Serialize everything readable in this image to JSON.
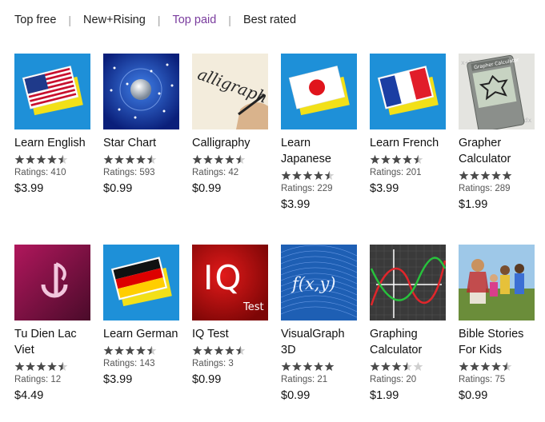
{
  "tabs": [
    {
      "label": "Top free",
      "active": false
    },
    {
      "label": "New+Rising",
      "active": false
    },
    {
      "label": "Top paid",
      "active": true
    },
    {
      "label": "Best rated",
      "active": false
    }
  ],
  "separator": "|",
  "apps": [
    {
      "name": "Learn English",
      "rating": 4.5,
      "ratings": "Ratings: 410",
      "price": "$3.99",
      "icon": "us-flag-icon"
    },
    {
      "name": "Star Chart",
      "rating": 4.5,
      "ratings": "Ratings: 593",
      "price": "$0.99",
      "icon": "star-chart-icon"
    },
    {
      "name": "Calligraphy",
      "rating": 4.5,
      "ratings": "Ratings: 42",
      "price": "$0.99",
      "icon": "calligraphy-icon"
    },
    {
      "name": "Learn Japanese",
      "rating": 4.5,
      "ratings": "Ratings: 229",
      "price": "$3.99",
      "icon": "japan-flag-icon"
    },
    {
      "name": "Learn French",
      "rating": 4.5,
      "ratings": "Ratings: 201",
      "price": "$3.99",
      "icon": "france-flag-icon"
    },
    {
      "name": "Grapher Calculator",
      "rating": 5,
      "ratings": "Ratings: 289",
      "price": "$1.99",
      "icon": "grapher-calculator-icon",
      "icon_text": "Grapher Calculator"
    },
    {
      "name": "Tu Dien Lac Viet",
      "rating": 4.5,
      "ratings": "Ratings: 12",
      "price": "$4.49",
      "icon": "lac-viet-logo-icon"
    },
    {
      "name": "Learn German",
      "rating": 4.5,
      "ratings": "Ratings: 143",
      "price": "$3.99",
      "icon": "germany-flag-icon"
    },
    {
      "name": "IQ Test",
      "rating": 4.5,
      "ratings": "Ratings: 3",
      "price": "$0.99",
      "icon": "iq-test-icon",
      "icon_text": "IQ",
      "icon_subtext": "Test"
    },
    {
      "name": "VisualGraph 3D",
      "rating": 5,
      "ratings": "Ratings: 21",
      "price": "$0.99",
      "icon": "function-graph-icon",
      "icon_text": "f(x,y)"
    },
    {
      "name": "Graphing Calculator",
      "rating": 3.5,
      "ratings": "Ratings: 20",
      "price": "$1.99",
      "icon": "graphing-calculator-icon"
    },
    {
      "name": "Bible Stories For Kids",
      "rating": 4.5,
      "ratings": "Ratings: 75",
      "price": "$0.99",
      "icon": "bible-stories-icon"
    }
  ],
  "colors": {
    "active_tab": "#7a3c9e",
    "tile_blue": "#1e90d8",
    "star": "#4a4a4a",
    "star_empty": "#cfcfcf"
  }
}
